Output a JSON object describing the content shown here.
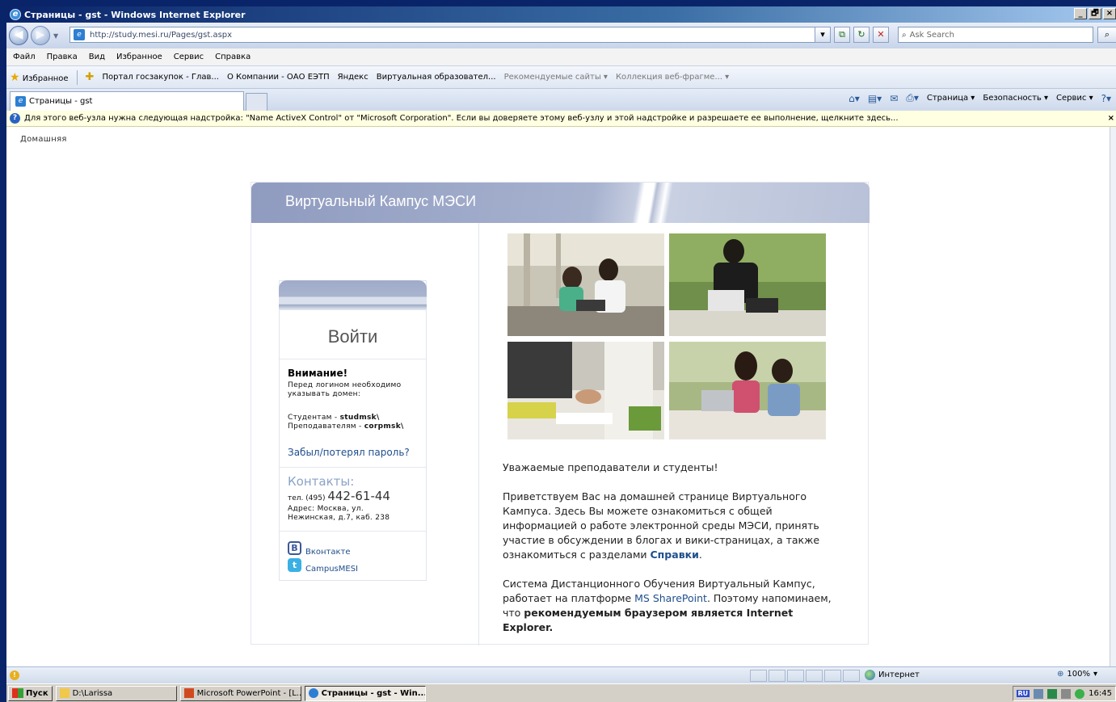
{
  "window": {
    "title": "Страницы - gst - Windows Internet Explorer",
    "buttons": [
      "_",
      "🗗",
      "×"
    ]
  },
  "address": {
    "url": "http://study.mesi.ru/Pages/gst.aspx",
    "search_placeholder": "Ask Search"
  },
  "menu": [
    "Файл",
    "Правка",
    "Вид",
    "Избранное",
    "Сервис",
    "Справка"
  ],
  "favorites": {
    "label": "Избранное",
    "items": [
      "Портал госзакупок - Глав...",
      "О Компании - ОАО ЕЭТП",
      "Яндекс",
      "Виртуальная образовател...",
      "Рекомендуемые сайты ▾",
      "Коллекция веб-фрагме... ▾"
    ]
  },
  "tab": {
    "label": "Страницы - gst"
  },
  "commandbar": [
    "Страница ▾",
    "Безопасность ▾",
    "Сервис ▾"
  ],
  "infobar": {
    "text": "Для этого веб-узла нужна следующая надстройка: \"Name ActiveX Control\" от \"Microsoft Corporation\". Если вы доверяете этому веб-узлу и этой надстройке и разрешаете ее выполнение, щелкните здесь..."
  },
  "page": {
    "breadcrumb": "Домашняя",
    "banner_title": "Виртуальный Кампус МЭСИ",
    "login": {
      "title": "Войти",
      "warning_title": "Внимание!",
      "warning_line1": "Перед логином необходимо",
      "warning_line2": "указывать домен:",
      "students_prefix": "Студентам - ",
      "students_domain": "studmsk\\",
      "teachers_prefix": "Преподавателям - ",
      "teachers_domain": "corpmsk\\",
      "forgot": "Забыл/потерял пароль?",
      "contacts_title": "Контакты:",
      "phone_prefix": "тел. (495) ",
      "phone_number": "442-61-44",
      "address_line1": "Адрес: Москва, ул.",
      "address_line2": "Нежинская, д.7, каб. 238",
      "vk_label": "Вконтакте",
      "twitter_label": "CampusMESI"
    },
    "welcome": {
      "greeting": "Уважаемые преподаватели и студенты!",
      "p2_a": "Приветствуем Вас на домашней странице Виртуального Кампуса. Здесь Вы можете ознакомиться с общей информацией о работе электронной среды МЭСИ, принять участие в обсуждении в блогах и вики-страницах, а также ознакомиться с разделами ",
      "p2_link": "Справки",
      "p2_end": ".",
      "p3_a": "Система Дистанционного Обучения Виртуальный Кампус, работает на платформе ",
      "p3_link": "MS SharePoint",
      "p3_b": ". Поэтому напоминаем, что ",
      "p3_bold": "рекомендуемым браузером является Internet Explorer."
    }
  },
  "status": {
    "zone": "Интернет",
    "zoom": "100%"
  },
  "taskbar": {
    "start": "Пуск",
    "items": [
      "D:\\Larissa",
      "Microsoft PowerPoint - [L...",
      "Страницы - gst - Win..."
    ],
    "lang": "RU",
    "clock": "16:45"
  }
}
